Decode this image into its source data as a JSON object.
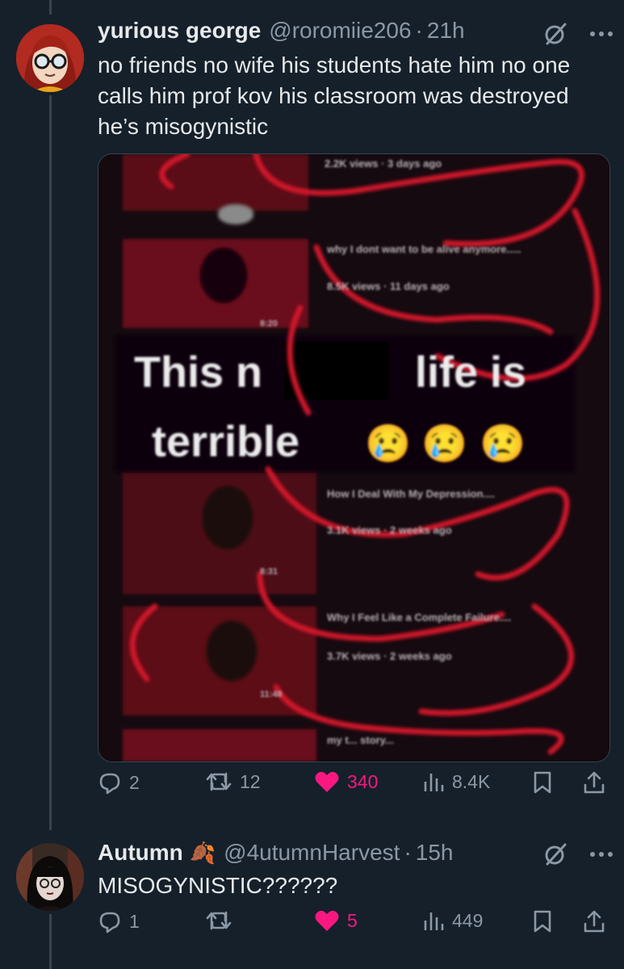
{
  "tweets": [
    {
      "author_name": "yurious george",
      "author_handle": "@roromiie206",
      "separator": "·",
      "time": "21h",
      "text": "no friends no wife his students hate him no one calls him prof kov his classroom was destroyed he’s misogynistic",
      "media": {
        "caption_line1_left": "This n",
        "caption_line1_right": "life is",
        "caption_line2": "terrible",
        "emoji": "😢",
        "video_texts": [
          {
            "title": "",
            "meta": "2.2K views · 3 days ago"
          },
          {
            "title": "why I dont want to be alive anymore.....",
            "meta": "8.5K views · 11 days ago"
          },
          {
            "title": "How I Deal With My Depression....",
            "meta": "3.1K views · 2 weeks ago"
          },
          {
            "title": "Why I Feel Like a Complete Failure....",
            "meta": "3.7K views · 2 weeks ago"
          },
          {
            "title": "my t... story...",
            "meta": ""
          }
        ],
        "durations": [
          "8:20",
          "8:31",
          "11:48"
        ]
      },
      "stats": {
        "replies": "2",
        "retweets": "12",
        "likes": "340",
        "views": "8.4K"
      }
    },
    {
      "author_name": "Autumn",
      "author_emoji": "🍂",
      "author_handle": "@4utumnHarvest",
      "separator": "·",
      "time": "15h",
      "text": "MISOGYNISTIC??????",
      "stats": {
        "replies": "1",
        "retweets": "",
        "likes": "5",
        "views": "449"
      }
    }
  ],
  "colors": {
    "background": "#15202b",
    "text": "#e7e9ea",
    "secondary": "#8b98a5",
    "like": "#f91880",
    "thread_line": "#38444d",
    "scribble_red": "#d3182a"
  },
  "icons": [
    "grok-icon",
    "more-icon",
    "reply-icon",
    "retweet-icon",
    "heart-icon",
    "views-icon",
    "bookmark-icon",
    "share-icon"
  ]
}
